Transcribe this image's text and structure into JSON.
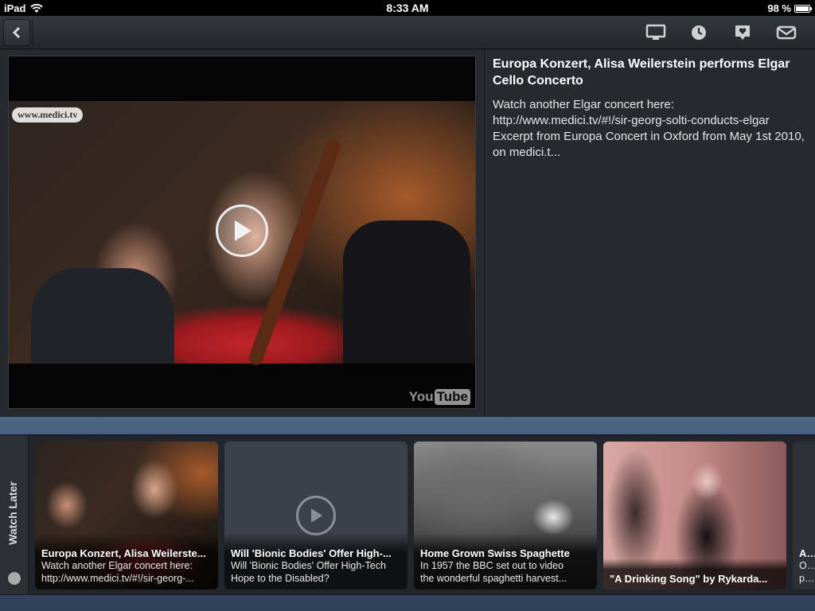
{
  "status": {
    "device": "iPad",
    "time": "8:33 AM",
    "battery": "98 %",
    "battery_level": 0.98
  },
  "toolbar": {
    "icons": [
      "back-icon",
      "tv-icon",
      "clock-icon",
      "heart-speech-icon",
      "mail-icon"
    ]
  },
  "video": {
    "watermark": "www.medici.tv",
    "logo_you": "You",
    "logo_tube": "Tube"
  },
  "description": {
    "title": "Europa Konzert, Alisa Weilerstein performs Elgar Cello Concerto",
    "body": "Watch another Elgar concert here: http://www.medici.tv/#!/sir-georg-solti-conducts-elgar Excerpt from Europa Concert in Oxford from May 1st 2010, on medici.t..."
  },
  "watch_later": {
    "label": "Watch Later",
    "cards": [
      {
        "title": "Europa Konzert, Alisa Weilerste...",
        "line1": "Watch another Elgar concert here:",
        "line2": "http://www.medici.tv/#!/sir-georg-..."
      },
      {
        "title": "Will 'Bionic Bodies' Offer High-...",
        "line1": "Will 'Bionic Bodies' Offer High-Tech",
        "line2": "Hope to the Disabled?"
      },
      {
        "title": "Home Grown Swiss Spaghette",
        "line1": "In 1957 the BBC set out to video",
        "line2": "the wonderful spaghetti harvest..."
      },
      {
        "title": "",
        "line1": "",
        "line2": "\"A Drinking Song\" by Rykarda..."
      },
      {
        "title": "ANI",
        "line1": "One",
        "line2": "piar"
      }
    ]
  }
}
